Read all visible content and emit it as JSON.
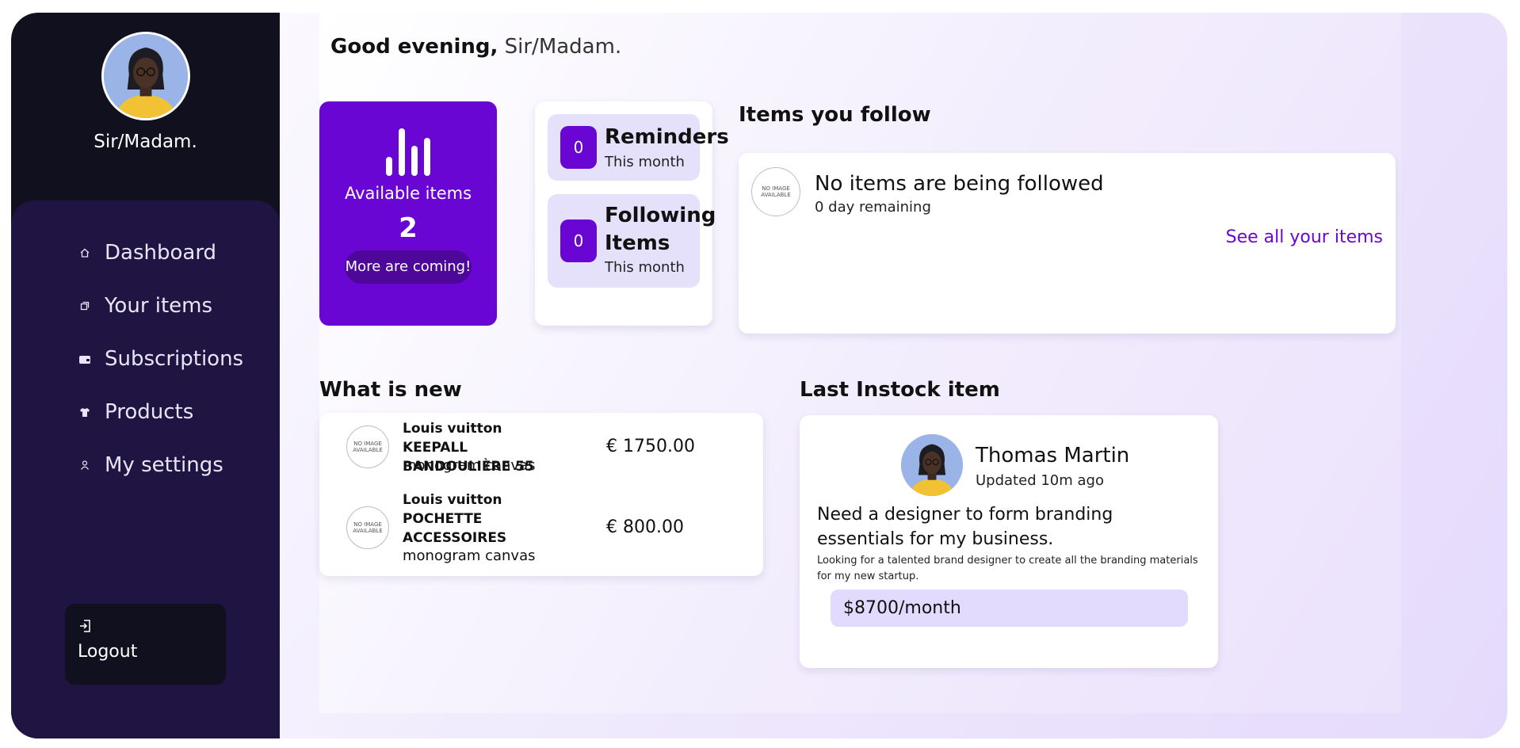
{
  "user": {
    "name": "Sir/Madam."
  },
  "greeting": {
    "prefix": "Good evening,",
    "name": "Sir/Madam."
  },
  "nav": {
    "items": [
      {
        "label": "Dashboard",
        "icon": "home-icon"
      },
      {
        "label": "Your items",
        "icon": "copy-icon"
      },
      {
        "label": "Subscriptions",
        "icon": "wallet-icon"
      },
      {
        "label": "Products",
        "icon": "shirt-icon"
      },
      {
        "label": "My settings",
        "icon": "user-icon"
      }
    ],
    "logout_label": "Logout"
  },
  "available": {
    "label": "Available items",
    "count": "2",
    "pill": "More are coming!"
  },
  "counters": {
    "reminders": {
      "value": "0",
      "title": "Reminders",
      "sub": "This month"
    },
    "following": {
      "value": "0",
      "title": "Following Items",
      "sub": "This month"
    }
  },
  "follow": {
    "title": "Items you follow",
    "no_image": "NO IMAGE AVAILABLE",
    "empty_title": "No items are being followed",
    "remaining": "0 day remaining",
    "see_all": "See all your items"
  },
  "whats_new": {
    "title": "What is new",
    "items": [
      {
        "name": "Louis vuitton KEEPALL BANDOULIÈRE 55",
        "desc": "monogram canvas",
        "price": "€ 1750.00"
      },
      {
        "name": "Louis vuitton POCHETTE ACCESSOIRES",
        "desc": "monogram canvas",
        "price": "€ 800.00"
      }
    ]
  },
  "instock": {
    "title": "Last Instock item",
    "name": "Thomas Martin",
    "updated": "Updated 10m ago",
    "headline": "Need a designer to form branding essentials for my business.",
    "description": "Looking for a talented brand designer to create all the branding materials for my new startup.",
    "price": "$8700/month"
  },
  "colors": {
    "accent": "#6a06d4",
    "sidebar": "#10101f",
    "nav_panel": "#1f1442",
    "link": "#6a06d4"
  }
}
